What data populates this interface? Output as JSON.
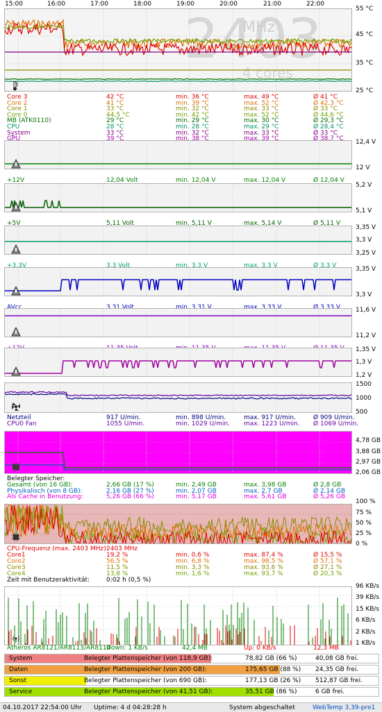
{
  "timeline": {
    "hours": [
      "15:00",
      "16:00",
      "17:00",
      "18:00",
      "19:00",
      "20:00",
      "21:00",
      "22:00"
    ]
  },
  "temp": {
    "overlay_big": "2403",
    "overlay_unit": "MHz",
    "overlay_cores": "4 cores",
    "axis": [
      "55 °C",
      "45 °C",
      "35 °C",
      "25 °C"
    ],
    "rows": [
      {
        "name": "Core 3",
        "cur": "42 °C",
        "min": "min. 36 °C",
        "max": "max. 49 °C",
        "avg": "Ø 41 °C",
        "color": "#e00000"
      },
      {
        "name": "Core 2",
        "cur": "41 °C",
        "min": "min. 39 °C",
        "max": "max. 52 °C",
        "avg": "Ø 42,3 °C",
        "color": "#e07000"
      },
      {
        "name": "Core 1",
        "cur": "33 °C",
        "min": "min. 32 °C",
        "max": "max. 33 °C",
        "avg": "Ø 33 °C",
        "color": "#8a8a00"
      },
      {
        "name": "Core 0",
        "cur": "44,5 °C",
        "min": "min. 42 °C",
        "max": "max. 52 °C",
        "avg": "Ø 44,6 °C",
        "color": "#70a000"
      },
      {
        "name": "MB (ATK0110)",
        "cur": "29 °C",
        "min": "min. 29 °C",
        "max": "max. 30 °C",
        "avg": "Ø 29,3 °C",
        "color": "#007000"
      },
      {
        "name": "CPU",
        "cur": "28 °C",
        "min": "min. 28 °C",
        "max": "max. 29 °C",
        "avg": "Ø 28,4 °C",
        "color": "#009060"
      },
      {
        "name": "System",
        "cur": "33 °C",
        "min": "min. 32 °C",
        "max": "max. 33 °C",
        "avg": "Ø 33 °C",
        "color": "#800080"
      },
      {
        "name": "GPU",
        "cur": "39 °C",
        "min": "min. 38 °C",
        "max": "max. 39 °C",
        "avg": "Ø 38,7 °C",
        "color": "#a000a0"
      }
    ]
  },
  "volt": [
    {
      "axis_top": "12,4 V",
      "axis_bottom": "12 V",
      "axis_mid": "",
      "name": "+12V",
      "cur": "12,04 Volt",
      "min": "min. 12,04 V",
      "max": "max. 12,04 V",
      "avg": "Ø 12,04 V",
      "color": "#008000"
    },
    {
      "axis_top": "5,2 V",
      "axis_bottom": "5,1 V",
      "axis_mid": "",
      "name": "+5V",
      "cur": "5,11 Volt",
      "min": "min. 5,11 V",
      "max": "max. 5,14 V",
      "avg": "Ø 5,11 V",
      "color": "#006000"
    },
    {
      "axis_top": "3,35 V",
      "axis_bottom": "3,25 V",
      "axis_mid": "3,3 V",
      "name": "+3,3V",
      "cur": "3,3 Volt",
      "min": "min. 3,3 V",
      "max": "max. 3,3 V",
      "avg": "Ø 3,3 V",
      "color": "#00a060"
    },
    {
      "axis_top": "3,35 V",
      "axis_bottom": "3,3 V",
      "axis_mid": "",
      "name": "AVcc",
      "cur": "3,31 Volt",
      "min": "min. 3,31 V",
      "max": "max. 3,33 V",
      "avg": "Ø 3,33 V",
      "color": "#0000c0"
    },
    {
      "axis_top": "11,6 V",
      "axis_bottom": "11,2 V",
      "axis_mid": "",
      "name": "+12V",
      "cur": "11,35 Volt",
      "min": "min. 11,35 V",
      "max": "max. 11,35 V",
      "avg": "Ø 11,35 V",
      "color": "#8000c0"
    },
    {
      "axis_top": "1,35 V",
      "axis_bottom": "1,2 V",
      "axis_mid": "1,3 V",
      "name": "Vcore",
      "cur": "1,28 Volt",
      "min": "min. 1,26 V",
      "max": "max. 1,28 V",
      "avg": "Ø 1,28 V",
      "color": "#a000a0"
    }
  ],
  "fan": {
    "axis": [
      "1500",
      "1000",
      "500"
    ],
    "rows": [
      {
        "name": "Netzteil",
        "cur": "917 U/min.",
        "min": "min. 898 U/min.",
        "max": "max. 917 U/min.",
        "avg": "Ø 909 U/min.",
        "color": "#000080"
      },
      {
        "name": "CPU0 Fan",
        "cur": "1055 U/min.",
        "min": "min. 1029 U/min.",
        "max": "max. 1223 U/min.",
        "avg": "Ø 1069 U/min.",
        "color": "#6000a0"
      }
    ]
  },
  "mem": {
    "axis": [
      "4,78 GB",
      "3,88 GB",
      "2,97 GB",
      "2,06 GB"
    ],
    "heading": "Belegter Speicher:",
    "rows": [
      {
        "name": "Gesamt (von 16 GB):",
        "cur": "2,66 GB (17 %)",
        "min": "min. 2,49 GB",
        "max": "max. 3,98 GB",
        "avg": "Ø 2,8 GB",
        "color": "#008000"
      },
      {
        "name": "Physikalisch (von 8 GB):",
        "cur": "2,16 GB (27 %)",
        "min": "min. 2,07 GB",
        "max": "max. 2,7 GB",
        "avg": "Ø 2,14 GB",
        "color": "#0060c0"
      },
      {
        "name": "Als Cache in Benutzung:",
        "cur": "5,26 GB (66 %)",
        "min": "min. 5,17 GB",
        "max": "max. 5,61 GB",
        "avg": "Ø 5,26 GB",
        "color": "#e000e0"
      }
    ]
  },
  "cpu": {
    "axis": [
      "100 %",
      "75 %",
      "50 %",
      "25 %",
      "0 %"
    ],
    "freq_label": "CPU-Frequenz (max. 2403 MHz):",
    "freq_value": "2403 MHz",
    "rows": [
      {
        "name": "Core1",
        "cur": "19,2 %",
        "min": "min. 0,6 %",
        "max": "max. 87,4 %",
        "avg": "Ø 15,5 %",
        "color": "#e00000"
      },
      {
        "name": "Core2",
        "cur": "56,5 %",
        "min": "min. 6,8 %",
        "max": "max. 98,5 %",
        "avg": "Ø 57,1 %",
        "color": "#e07000"
      },
      {
        "name": "Core3",
        "cur": "11,5 %",
        "min": "min. 3,3 %",
        "max": "max. 93,6 %",
        "avg": "Ø 27,1 %",
        "color": "#8a8a00"
      },
      {
        "name": "Core4",
        "cur": "13,8 %",
        "min": "min. 1,6 %",
        "max": "max. 93,7 %",
        "avg": "Ø 20,3 %",
        "color": "#70a000"
      }
    ],
    "activity_label": "Zeit mit Benutzeraktivität:",
    "activity_value": "0:02 h (0,5 %)"
  },
  "net": {
    "axis": [
      "96 KB/s",
      "39 KB/s",
      "15 KB/s",
      "6 KB/s",
      "2 KB/s",
      "1 KB/s"
    ],
    "adapter": "Atheros AR8121/AR8113/AR8114",
    "down": "Down: 1 KB/s",
    "down_total": "42,4 MB",
    "up": "Up: 0 KB/s",
    "up_total": "12,3 MB"
  },
  "disks": [
    {
      "name": "System",
      "desc": "Belegter Plattenspeicher (von 118,9 GB):",
      "used": "78,82 GB (66 %)",
      "free": "40,08 GB frei.",
      "percent": 66,
      "color": "#f08080"
    },
    {
      "name": "Daten",
      "desc": "Belegter Plattenspeicher (von 200 GB):",
      "used": "175,65 GB (88 %)",
      "free": "24,35 GB frei.",
      "percent": 88,
      "color": "#f0a040"
    },
    {
      "name": "Sonst",
      "desc": "Belegter Plattenspeicher (von 690 GB):",
      "used": "177,13 GB (26 %)",
      "free": "512,87 GB frei.",
      "percent": 26,
      "color": "#f0f000"
    },
    {
      "name": "Service",
      "desc": "Belegter Plattenspeicher (von 41,51 GB):",
      "used": "35,51 GB (86 %)",
      "free": "6 GB frei.",
      "percent": 86,
      "color": "#a0e000"
    }
  ],
  "status": {
    "datetime": "04.10.2017 22:54:00 Uhr",
    "uptime": "Uptime: 4 d 04:28:28 h",
    "system_state": "System abgeschaltet",
    "app_version": "WebTemp 3.39-pre1"
  },
  "colors": {
    "temp_bg": "#f4f4f4",
    "mem_fill": "#ff00ff",
    "cpu_bg": "#e8b8b8",
    "net_bar_green": "#008000",
    "net_bar_red": "#e00000"
  }
}
